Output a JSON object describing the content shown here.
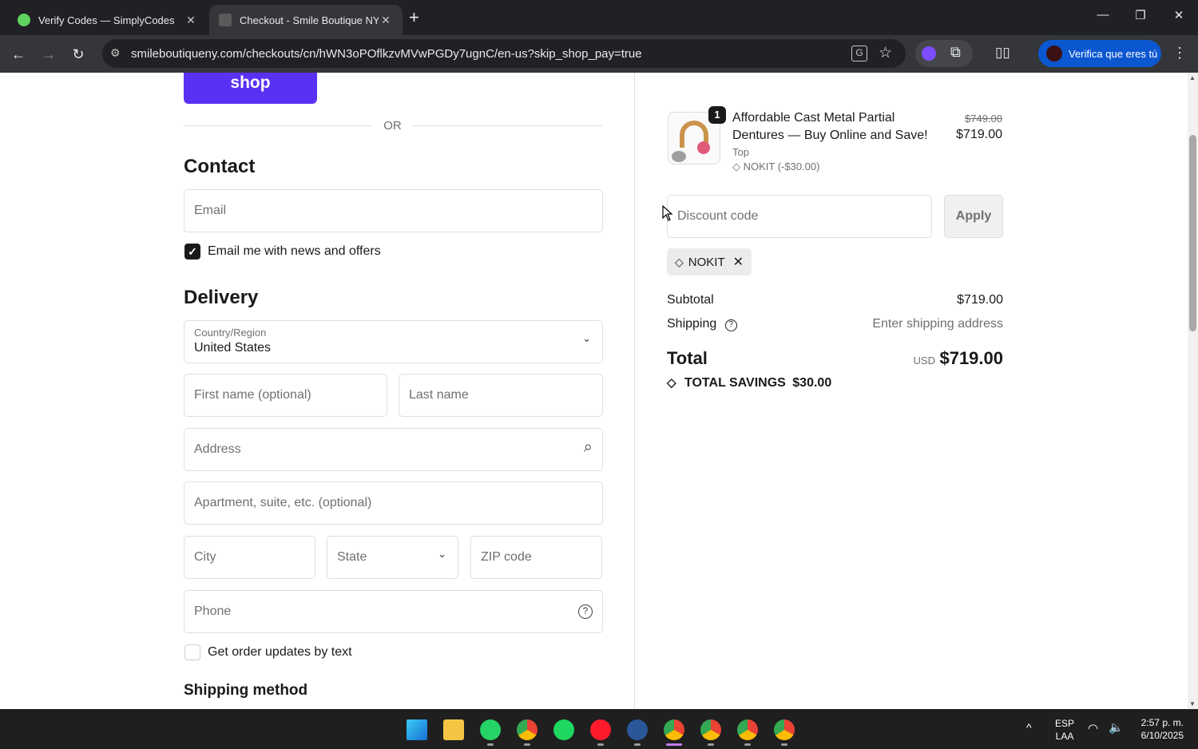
{
  "browser": {
    "tabs": [
      {
        "title": "Verify Codes — SimplyCodes",
        "close": "✕"
      },
      {
        "title": "Checkout - Smile Boutique NY",
        "close": "✕"
      }
    ],
    "new_tab": "+",
    "window_controls": {
      "minimize": "—",
      "maximize": "❐",
      "close": "✕"
    },
    "nav": {
      "back": "←",
      "forward": "→",
      "reload": "↻"
    },
    "url": "smileboutiqueny.com/checkouts/cn/hWN3oPOflkzvMVwPGDy7ugnC/en-us?skip_shop_pay=true",
    "translate_glyph": "G",
    "star": "☆",
    "extension_glyph": "⧉",
    "reader_glyph": "▯▯",
    "profile_label": "Verifica que eres tú",
    "menu": "⋮",
    "colors": {
      "accent": "#0b57d0",
      "frame": "#202124",
      "toolbar": "#35363a"
    }
  },
  "checkout": {
    "shop_pay_label": "shop",
    "or_divider": "OR",
    "contact": {
      "heading": "Contact",
      "email_placeholder": "Email",
      "newsletter_check": "✓",
      "newsletter_label": "Email me with news and offers"
    },
    "delivery": {
      "heading": "Delivery",
      "country_label": "Country/Region",
      "country_value": "United States",
      "first_name_placeholder": "First name (optional)",
      "last_name_placeholder": "Last name",
      "address_placeholder": "Address",
      "apartment_placeholder": "Apartment, suite, etc. (optional)",
      "city_placeholder": "City",
      "state_placeholder": "State",
      "zip_placeholder": "ZIP code",
      "phone_placeholder": "Phone",
      "sms_label": "Get order updates by text"
    },
    "shipping_method_heading": "Shipping method",
    "icons": {
      "chevron": "⌄",
      "search": "⌕",
      "help": "?"
    },
    "colors": {
      "shop_pay": "#5a31f4",
      "text": "#1a1a1a",
      "muted": "#707070",
      "border": "#dedede"
    }
  },
  "summary": {
    "item": {
      "quantity": "1",
      "title": "Affordable Cast Metal Partial Dentures — Buy Online and Save!",
      "variant": "Top",
      "discount_line": "NOKIT (-$30.00)",
      "original_price": "$749.00",
      "price": "$719.00"
    },
    "discount_placeholder": "Discount code",
    "apply_label": "Apply",
    "applied_code": "NOKIT",
    "remove_glyph": "✕",
    "tag_glyph": "◇",
    "subtotal_label": "Subtotal",
    "subtotal_value": "$719.00",
    "shipping_label": "Shipping",
    "shipping_help": "?",
    "shipping_value": "Enter shipping address",
    "total_label": "Total",
    "total_currency": "USD",
    "total_value": "$719.00",
    "savings_label": "TOTAL SAVINGS",
    "savings_value": "$30.00"
  },
  "taskbar": {
    "apps": [
      "windows-start",
      "file-explorer",
      "whatsapp",
      "chrome",
      "spotify",
      "opera",
      "word",
      "chrome-active",
      "chrome-profile-2",
      "chrome-profile-3",
      "chrome-profile-4"
    ],
    "lang_top": "ESP",
    "lang_bottom": "LAA",
    "time": "2:57 p. m.",
    "date": "6/10/2025",
    "tray_chevron": "^",
    "wifi": "◠",
    "volume": "🔈"
  }
}
